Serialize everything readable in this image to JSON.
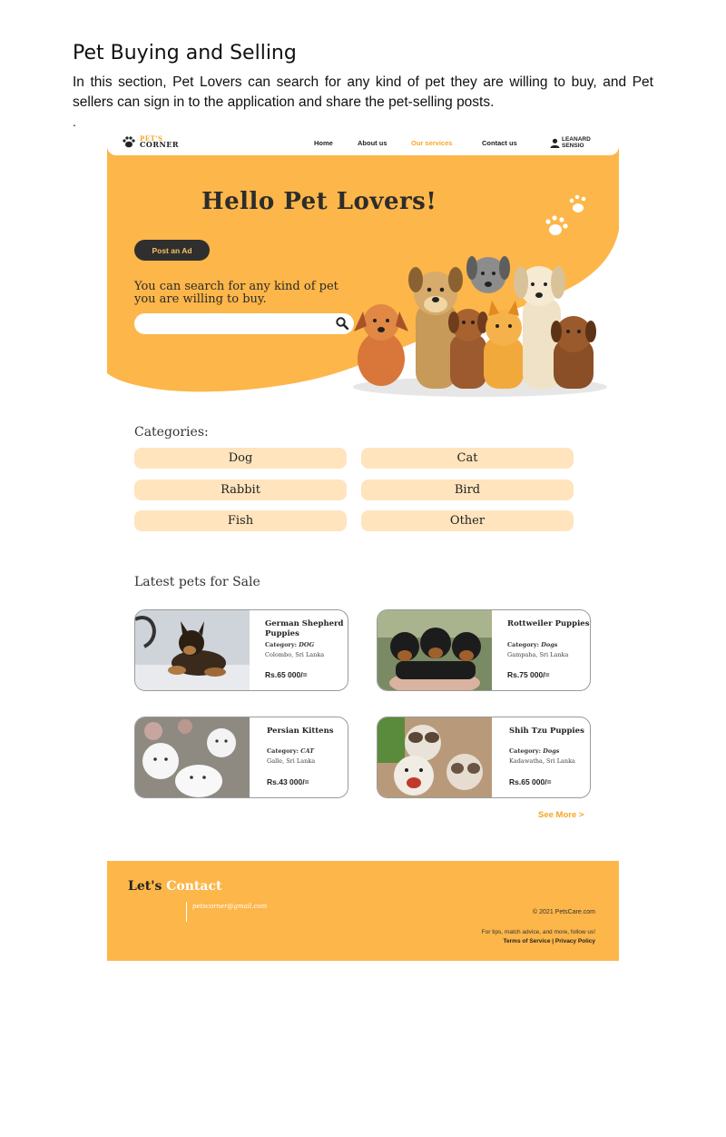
{
  "document": {
    "title": "Pet Buying and Selling",
    "body": "In this section, Pet Lovers can search for any kind of pet they are willing to buy, and Pet sellers can sign in to the application and share the pet-selling posts.",
    "dot": "."
  },
  "nav": {
    "logo_line1": "PET'S",
    "logo_line2": "CORNER",
    "items": [
      "Home",
      "About us",
      "Our services",
      "Contact us"
    ],
    "active_item": "Our services",
    "user_first": "LEANARD",
    "user_last": "SENSIO"
  },
  "hero": {
    "title": "Hello Pet Lovers!",
    "post_button": "Post an Ad",
    "subtitle_line1": "You can search for any kind of pet",
    "subtitle_line2": "you are willing to buy.",
    "search_value": ""
  },
  "categories": {
    "title": "Categories:",
    "items": [
      "Dog",
      "Cat",
      "Rabbit",
      "Bird",
      "Fish",
      "Other"
    ]
  },
  "latest": {
    "title": "Latest pets for Sale",
    "cards": [
      {
        "name": "German Shepherd Puppies",
        "category_label": "Category:",
        "category": "DOG",
        "location": "Colombo, Sri Lanka",
        "price": "Rs.65 000/="
      },
      {
        "name": "Rottweiler Puppies",
        "category_label": "Category:",
        "category": "Dogs",
        "location": "Gampaha, Sri Lanka",
        "price": "Rs.75 000/="
      },
      {
        "name": "Persian Kittens",
        "category_label": "Category:",
        "category": "CAT",
        "location": "Galle, Sri Lanka",
        "price": "Rs.43 000/="
      },
      {
        "name": "Shih Tzu Puppies",
        "category_label": "Category:",
        "category": "Dogs",
        "location": "Kadawatha, Sri Lanka",
        "price": "Rs.65 000/="
      }
    ],
    "see_more": "See More >"
  },
  "footer": {
    "title_prefix": "Let's",
    "title_highlight": "Contact",
    "email": "petscorner@gmail.com",
    "copyright": "© 2021 PetsCare.com",
    "tips": "For tips, match advice, and more, follow us!",
    "terms": "Terms of Service",
    "separator": "|",
    "privacy": "Privacy Policy"
  },
  "colors": {
    "accent": "#fdb649",
    "category_bg": "#ffe4bd",
    "dark_button": "#2f2f2f"
  }
}
